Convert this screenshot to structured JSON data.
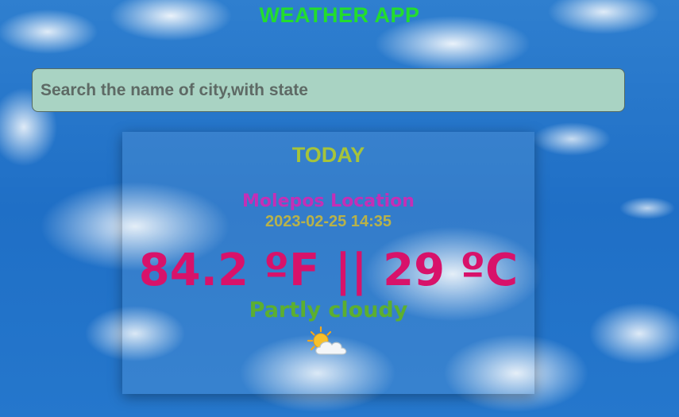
{
  "header": {
    "title": "WEATHER APP"
  },
  "search": {
    "placeholder": "Search the name of city,with state",
    "value": ""
  },
  "card": {
    "heading": "TODAY",
    "location": "Molepos Location",
    "datetime": "2023-02-25 14:35",
    "temperature": "84.2 ºF || 29 ºC",
    "condition": "Partly cloudy",
    "icon": "partly-cloudy-icon"
  },
  "colors": {
    "title": "#22dd2e",
    "search_bg": "#a9d3c3",
    "heading": "#a6c43a",
    "location": "#c42fb6",
    "datetime": "#b8b24a",
    "temperature": "#d8126a",
    "condition": "#5caf30"
  }
}
